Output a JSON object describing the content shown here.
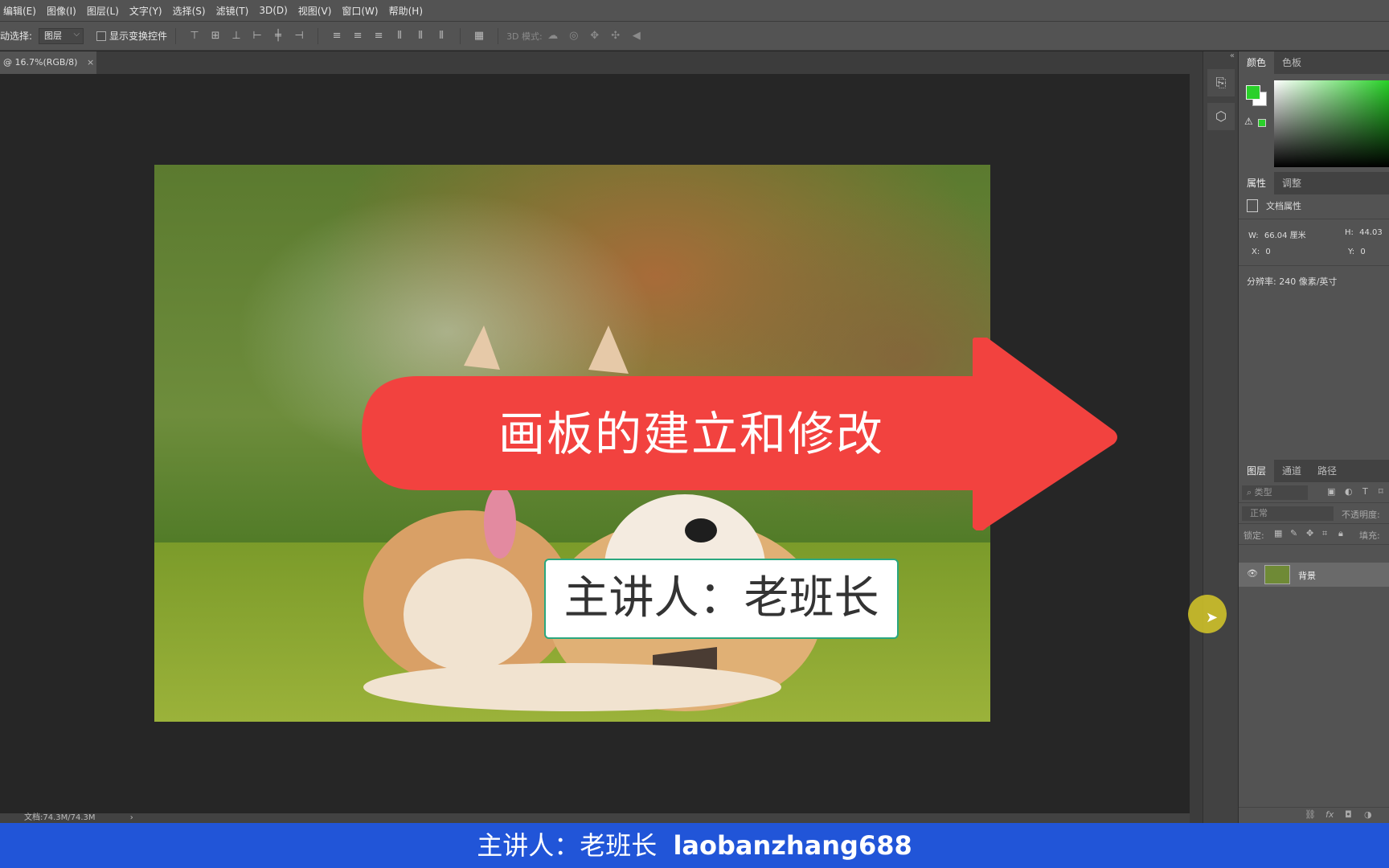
{
  "menu": [
    "编辑(E)",
    "图像(I)",
    "图层(L)",
    "文字(Y)",
    "选择(S)",
    "滤镜(T)",
    "3D(D)",
    "视图(V)",
    "窗口(W)",
    "帮助(H)"
  ],
  "options": {
    "auto_select_label": "动选择:",
    "auto_select_value": "图层",
    "show_transform": "显示变换控件",
    "mode3d": "3D 模式:"
  },
  "doc_tab": {
    "title": "@ 16.7%(RGB/8)",
    "close": "×"
  },
  "canvas_text": {
    "arrow_title": "画板的建立和修改",
    "speaker": "主讲人：老班长"
  },
  "status": {
    "doc": "文档:74.3M/74.3M",
    "arrow": "›"
  },
  "panels": {
    "color_tabs": [
      "颜色",
      "色板"
    ],
    "prop_tabs": [
      "属性",
      "调整"
    ],
    "doc_props": "文档属性",
    "w_label": "W:",
    "w_value": "66.04 厘米",
    "h_label": "H:",
    "h_value": "44.03",
    "x_label": "X:",
    "x_value": "0",
    "y_label": "Y:",
    "y_value": "0",
    "resolution": "分辨率: 240 像素/英寸",
    "layer_tabs": [
      "图层",
      "通道",
      "路径"
    ],
    "filter_placeholder": "类型",
    "blend_mode": "正常",
    "opacity_label": "不透明度:",
    "lock_label": "锁定:",
    "fill_label": "填充:",
    "layer_name": "背景"
  },
  "caption": {
    "text": "主讲人：老班长",
    "handle": "laobanzhang688"
  },
  "colors": {
    "foreground": "#2ad02a",
    "arrow": "#f2423f",
    "caption_bg": "#2155d8"
  }
}
